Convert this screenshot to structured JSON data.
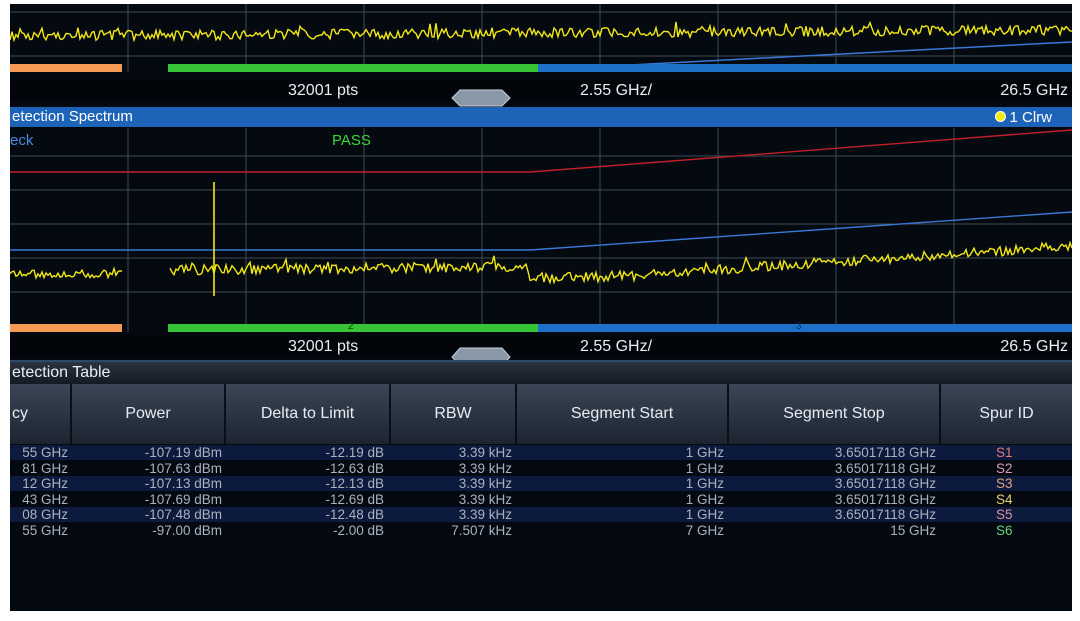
{
  "top_pane": {
    "axis": {
      "points": "32001 pts",
      "step": "2.55 GHz/",
      "stop": "26.5 GHz"
    }
  },
  "spectrum_pane": {
    "title": "etection Spectrum",
    "trace_badge": "1 Clrw",
    "check_label": "eck",
    "check_result": "PASS",
    "segment_labels": [
      "2",
      "3"
    ],
    "axis": {
      "points": "32001 pts",
      "step": "2.55 GHz/",
      "stop": "26.5 GHz"
    }
  },
  "table": {
    "title": "etection Table",
    "columns": [
      "cy",
      "Power",
      "Delta to Limit",
      "RBW",
      "Segment Start",
      "Segment Stop",
      "Spur ID"
    ],
    "rows": [
      {
        "freq": "55 GHz",
        "power": "-107.19 dBm",
        "delta": "-12.19 dB",
        "rbw": "3.39 kHz",
        "start": "1 GHz",
        "stop": "3.65017118 GHz",
        "spur": "S1"
      },
      {
        "freq": "81 GHz",
        "power": "-107.63 dBm",
        "delta": "-12.63 dB",
        "rbw": "3.39 kHz",
        "start": "1 GHz",
        "stop": "3.65017118 GHz",
        "spur": "S2"
      },
      {
        "freq": "12 GHz",
        "power": "-107.13 dBm",
        "delta": "-12.13 dB",
        "rbw": "3.39 kHz",
        "start": "1 GHz",
        "stop": "3.65017118 GHz",
        "spur": "S3"
      },
      {
        "freq": "43 GHz",
        "power": "-107.69 dBm",
        "delta": "-12.69 dB",
        "rbw": "3.39 kHz",
        "start": "1 GHz",
        "stop": "3.65017118 GHz",
        "spur": "S4"
      },
      {
        "freq": "08 GHz",
        "power": "-107.48 dBm",
        "delta": "-12.48 dB",
        "rbw": "3.39 kHz",
        "start": "1 GHz",
        "stop": "3.65017118 GHz",
        "spur": "S5"
      },
      {
        "freq": "55 GHz",
        "power": "-97.00 dBm",
        "delta": "-2.00 dB",
        "rbw": "7.507 kHz",
        "start": "7 GHz",
        "stop": "15 GHz",
        "spur": "S6"
      }
    ],
    "spur_colors": [
      "#e07a7a",
      "#d8a0b4",
      "#e0a080",
      "#e8d070",
      "#e090a0",
      "#6ad07a"
    ]
  },
  "colors": {
    "trace": "#f2e813",
    "limit_line": "#c0202a",
    "threshold_line": "#3a78d8",
    "segment_1": "#f49a52",
    "segment_2": "#36c436",
    "segment_3": "#1e70c8",
    "title_bar": "#1d63b8",
    "pass": "#3ad43a"
  }
}
